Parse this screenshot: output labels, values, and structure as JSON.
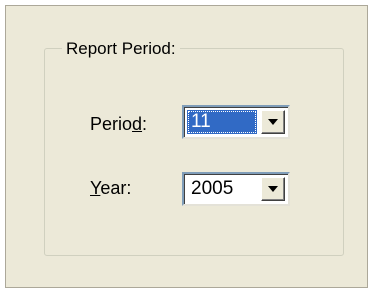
{
  "group": {
    "title": "Report Period:"
  },
  "period": {
    "label_before": "Perio",
    "label_mnemonic": "d",
    "label_after": ":",
    "value": "11"
  },
  "year": {
    "label_before": "",
    "label_mnemonic": "Y",
    "label_after": "ear:",
    "value": "2005"
  },
  "icons": {
    "dropdown": "chevron-down-icon"
  },
  "colors": {
    "panel_background": "#ECE9D8",
    "selection": "#316AC5"
  }
}
